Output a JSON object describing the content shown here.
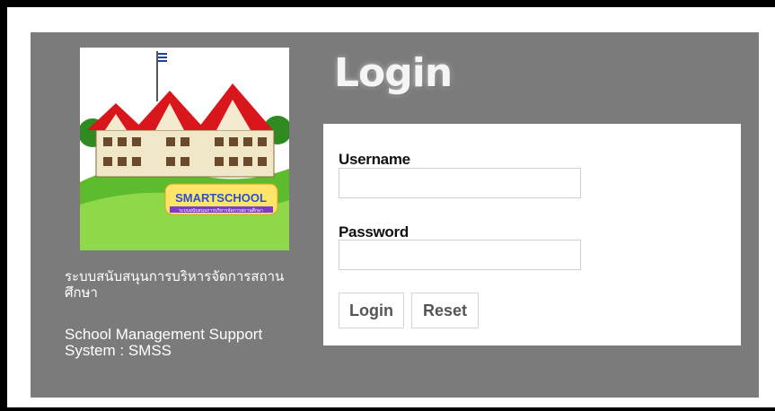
{
  "logo": {
    "badge_text": "SMARTSCHOOL",
    "badge_subtext": "ระบบสนับสนุนการบริหารจัดการสถานศึกษา"
  },
  "caption": {
    "thai": "ระบบสนับสนุนการบริหารจัดการสถานศึกษา",
    "english": "School Management Support System : SMSS"
  },
  "login": {
    "title": "Login",
    "username_label": "Username",
    "username_value": "",
    "password_label": "Password",
    "password_value": "",
    "login_button": "Login",
    "reset_button": "Reset"
  },
  "colors": {
    "panel": "#7b7b7b",
    "frame": "#000000",
    "card": "#ffffff"
  }
}
